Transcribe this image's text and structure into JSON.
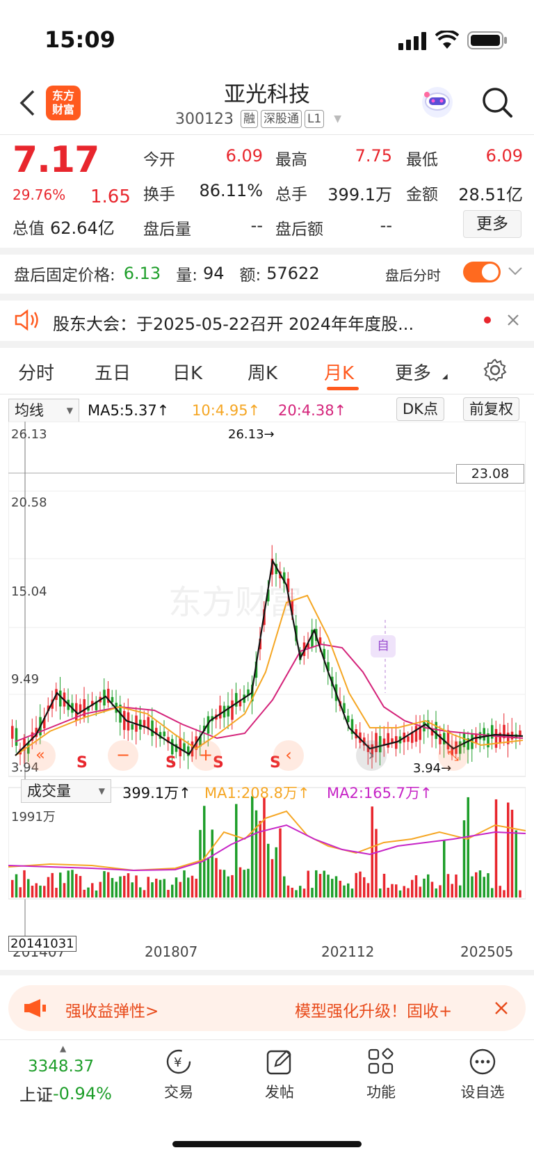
{
  "status": {
    "time": "15:09"
  },
  "nav": {
    "logo_line1": "东方",
    "logo_line2": "财富",
    "stock_name": "亚光科技",
    "code": "300123",
    "tags": [
      "融",
      "深股通",
      "L1"
    ]
  },
  "quote": {
    "price": "7.17",
    "change_pct": "29.76%",
    "change": "1.65",
    "open_label": "今开",
    "open": "6.09",
    "high_label": "最高",
    "high": "7.75",
    "low_label": "最低",
    "low": "6.09",
    "turnover_label": "换手",
    "turnover": "86.11%",
    "volume_label": "总手",
    "volume": "399.1万",
    "amount_label": "金额",
    "amount": "28.51亿",
    "mktcap_label": "总值",
    "mktcap": "62.64亿",
    "after_vol_label": "盘后量",
    "after_vol": "--",
    "after_amt_label": "盘后额",
    "after_amt": "--",
    "more_label": "更多"
  },
  "after_hours": {
    "price_label": "盘后固定价格:",
    "price": "6.13",
    "vol_label": "量:",
    "vol": "94",
    "amt_label": "额:",
    "amt": "57622",
    "toggle_label": "盘后分时"
  },
  "notice": {
    "text": "股东大会：于2025-05-22召开 2024年年度股..."
  },
  "tabs": [
    "分时",
    "五日",
    "日K",
    "周K",
    "月K",
    "更多"
  ],
  "active_tab": "月K",
  "ma_bar": {
    "selector": "均线",
    "ma5": "MA5:5.37↑",
    "ma10": "10:4.95↑",
    "ma20": "20:4.38↑",
    "dk_button": "DK点",
    "adjust_button": "前复权"
  },
  "price_axis": [
    "26.13",
    "20.58",
    "15.04",
    "9.49",
    "3.94"
  ],
  "annotations": {
    "high": "26.13→",
    "low": "3.94→",
    "ref_price": "23.08",
    "self_marker": "自",
    "signal": "S"
  },
  "volume_bar": {
    "selector": "成交量",
    "value": "399.1万↑",
    "ma1": "MA1:208.8万↑",
    "ma2": "MA2:165.7万↑",
    "max_label": "1991万"
  },
  "date_labels": {
    "crosshair": "20141031",
    "first": "201407",
    "d2": "201807",
    "d3": "202112",
    "d4": "202505"
  },
  "banner": {
    "left": "强收益弹性>",
    "right": "模型强化升级！固收+"
  },
  "bottom_nav": {
    "index_value": "3348.37",
    "index_name": "上证",
    "index_change": "-0.94%",
    "items": [
      "交易",
      "发帖",
      "功能",
      "设自选"
    ]
  },
  "colors": {
    "up": "#e8262d",
    "down": "#1e9e2a",
    "accent": "#ff5a1f",
    "ma5": "#111111",
    "ma10": "#f5a623",
    "ma20": "#d4237a"
  }
}
